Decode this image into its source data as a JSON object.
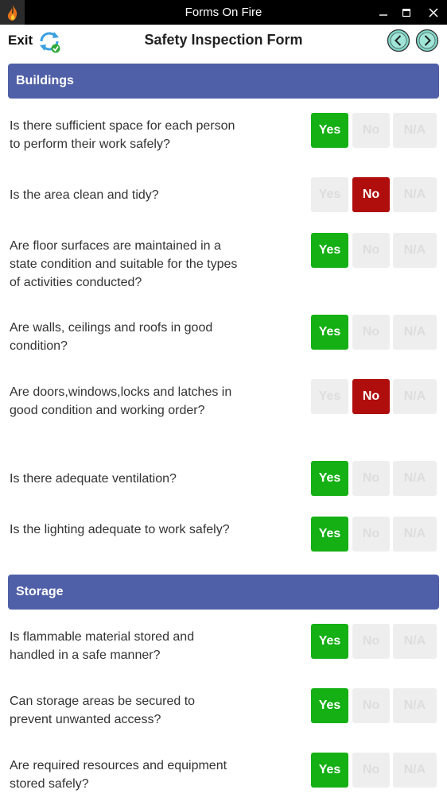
{
  "window": {
    "title": "Forms On Fire",
    "minimize": "−",
    "maximize": "□",
    "close": "✕"
  },
  "header": {
    "exit_label": "Exit",
    "form_title": "Safety Inspection Form"
  },
  "labels": {
    "yes": "Yes",
    "no": "No",
    "na": "N/A"
  },
  "colors": {
    "section_bg": "#5060a8",
    "yes_selected": "#14b014",
    "no_selected": "#b00d0d",
    "unselected_bg": "#eeeeee",
    "nav_button": "#7fd8c8"
  },
  "sections": [
    {
      "title": "Buildings",
      "questions": [
        {
          "text": "Is there sufficient space for each person to perform their work safely?",
          "answer": "Yes"
        },
        {
          "text": "Is the area clean and tidy?",
          "answer": "No"
        },
        {
          "text": "Are floor surfaces are maintained in a state condition and suitable for the types of activities conducted?",
          "answer": "Yes"
        },
        {
          "text": "Are walls, ceilings and roofs in good condition?",
          "answer": "Yes"
        },
        {
          "text": "Are doors,windows,locks and latches in good condition and working order?",
          "answer": "No"
        },
        {
          "text": "Is there adequate ventilation?",
          "answer": "Yes"
        },
        {
          "text": "Is the lighting adequate to work safely?",
          "answer": "Yes"
        }
      ]
    },
    {
      "title": "Storage",
      "questions": [
        {
          "text": "Is flammable material stored and handled in a safe manner?",
          "answer": "Yes"
        },
        {
          "text": "Can storage areas be secured to prevent unwanted access?",
          "answer": "Yes"
        },
        {
          "text": "Are required resources and equipment stored safely?",
          "answer": "Yes"
        }
      ]
    }
  ]
}
